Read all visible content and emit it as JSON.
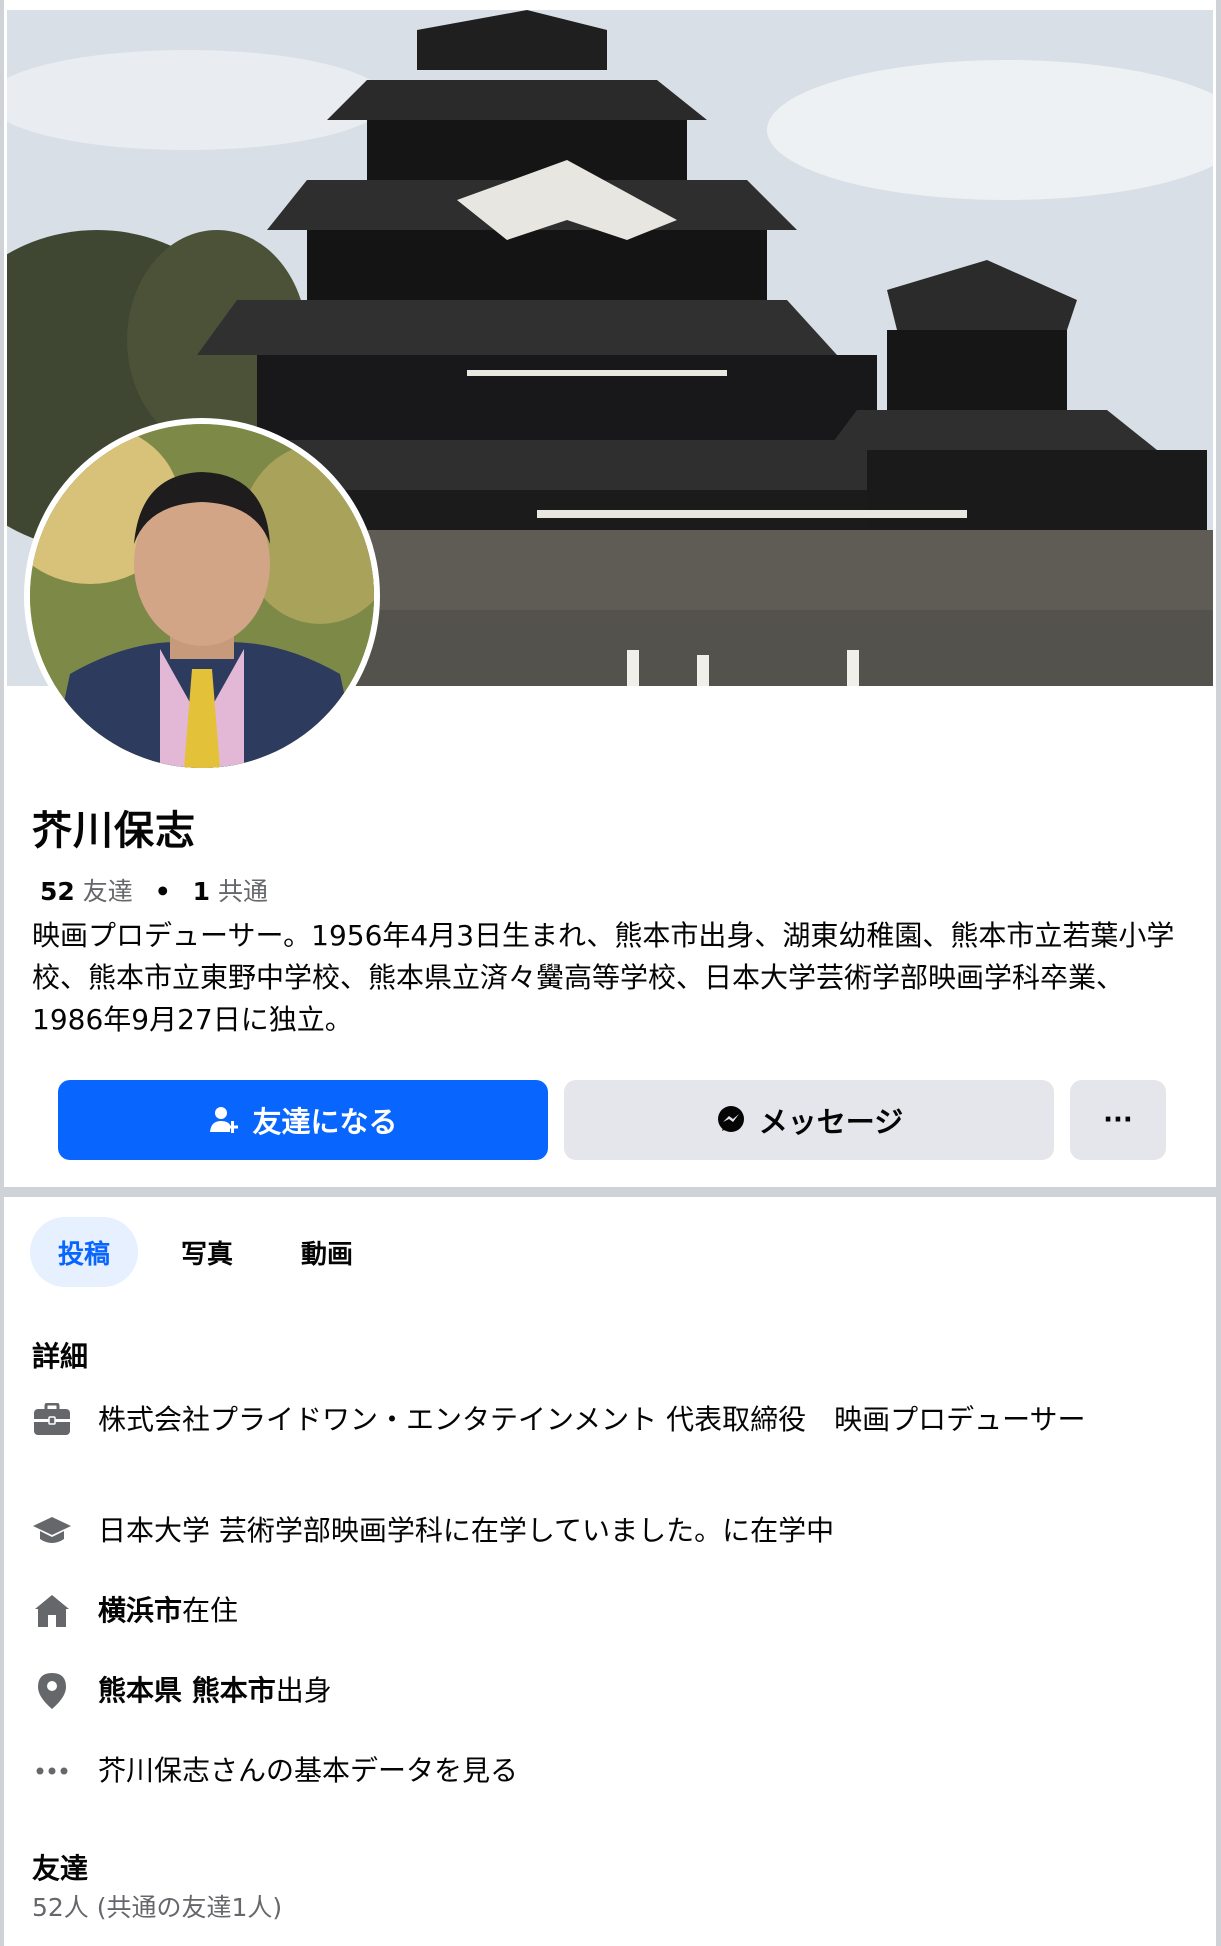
{
  "profile": {
    "name": "芥川保志",
    "friends_count": "52",
    "friends_label": "友達",
    "mutual_count": "1",
    "mutual_label": "共通",
    "bio": "映画プロデューサー。1956年4月3日生まれ、熊本市出身、湖東幼稚園、熊本市立若葉小学校、熊本市立東野中学校、熊本県立済々黌高等学校、日本大学芸術学部映画学科卒業、1986年9月27日に独立。"
  },
  "actions": {
    "add_friend": "友達になる",
    "message": "メッセージ",
    "more": "···"
  },
  "tabs": [
    {
      "label": "投稿",
      "active": true
    },
    {
      "label": "写真",
      "active": false
    },
    {
      "label": "動画",
      "active": false
    }
  ],
  "details": {
    "title": "詳細",
    "work": "株式会社プライドワン・エンタテインメント 代表取締役　映画プロデューサー",
    "education": "日本大学 芸術学部映画学科に在学していました。に在学中",
    "residence_place": "横浜市",
    "residence_suffix": "在住",
    "hometown_place": "熊本県 熊本市",
    "hometown_suffix": "出身",
    "see_more": "芥川保志さんの基本データを見る"
  },
  "friends": {
    "title": "友達",
    "summary": "52人 (共通の友達1人)"
  },
  "icons": [
    "person-add-icon",
    "messenger-icon",
    "more-icon",
    "briefcase-icon",
    "graduation-cap-icon",
    "home-icon",
    "location-pin-icon",
    "ellipsis-icon"
  ],
  "colors": {
    "accent": "#0866ff",
    "secondary_button": "#e4e6eb",
    "muted_text": "#65676b",
    "active_tab_bg": "#e7f0ff"
  }
}
